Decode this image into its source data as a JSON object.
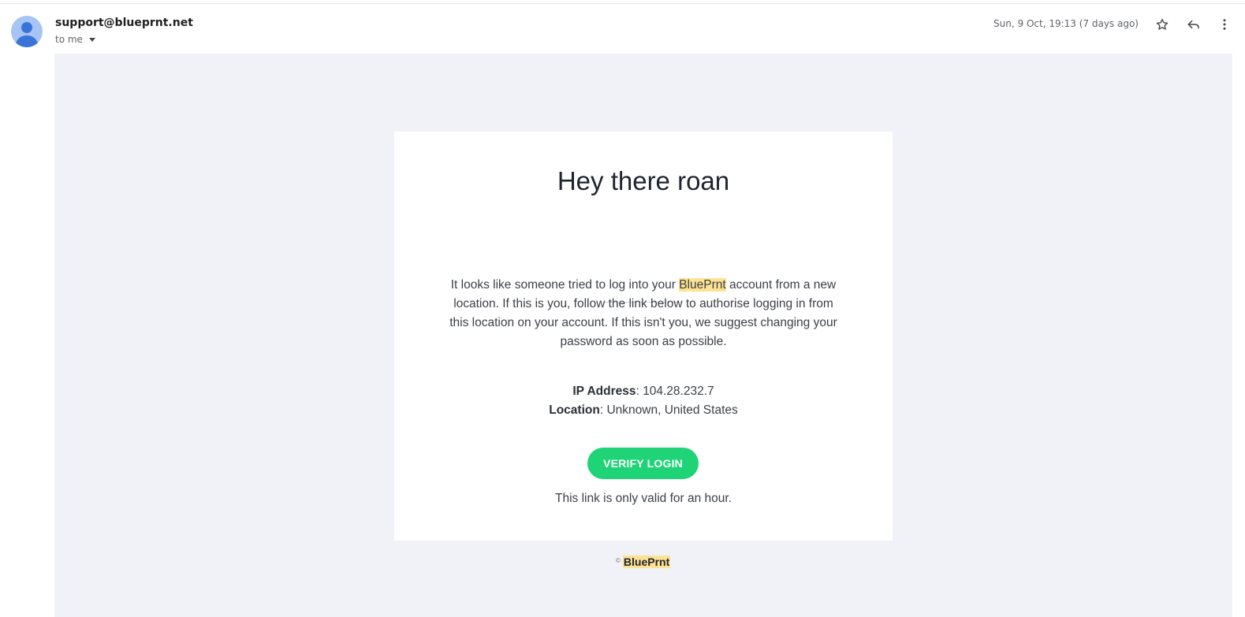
{
  "header": {
    "sender": "support@blueprnt.net",
    "to_label": "to me",
    "date": "Sun, 9 Oct, 19:13 (7 days ago)",
    "icons": [
      "star-icon",
      "reply-icon",
      "more-vert-icon"
    ]
  },
  "email": {
    "title": "Hey there roan",
    "body_before": "It looks like someone tried to log into your ",
    "brand_highlight": "BluePrnt",
    "body_after": " account from a new location. If this is you, follow the link below to authorise logging in from this location on your account. If this isn't you, we suggest changing your password as soon as possible.",
    "ip_label": "IP Address",
    "ip_value": ": 104.28.232.7",
    "location_label": "Location",
    "location_value": ": Unknown, United States",
    "verify_button": "VERIFY LOGIN",
    "validity_note": "This link is only valid for an hour."
  },
  "footer": {
    "copyright": "©",
    "brand": "BluePrnt"
  },
  "colors": {
    "background": "#f1f2f7",
    "card": "#ffffff",
    "button": "#1ed476",
    "highlight": "#fde293",
    "avatar": "#a8c4f4"
  }
}
